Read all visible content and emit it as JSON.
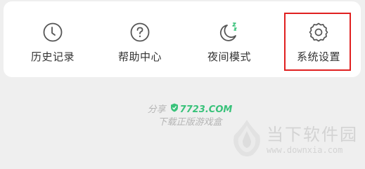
{
  "menu": {
    "items": [
      {
        "label": "历史记录",
        "icon": "clock-icon"
      },
      {
        "label": "帮助中心",
        "icon": "question-icon"
      },
      {
        "label": "夜间模式",
        "icon": "moon-icon"
      },
      {
        "label": "系统设置",
        "icon": "gear-icon"
      }
    ],
    "highlighted": "系统设置",
    "highlight_color": "#e02020",
    "icon_color": "#555555"
  },
  "footer": {
    "share_label": "分享",
    "brand": "7723.COM",
    "brand_color": "#39c27a",
    "tagline": "下载正版游戏盒"
  },
  "watermark": {
    "name": "当下软件园",
    "url": "www.downxia.com"
  }
}
